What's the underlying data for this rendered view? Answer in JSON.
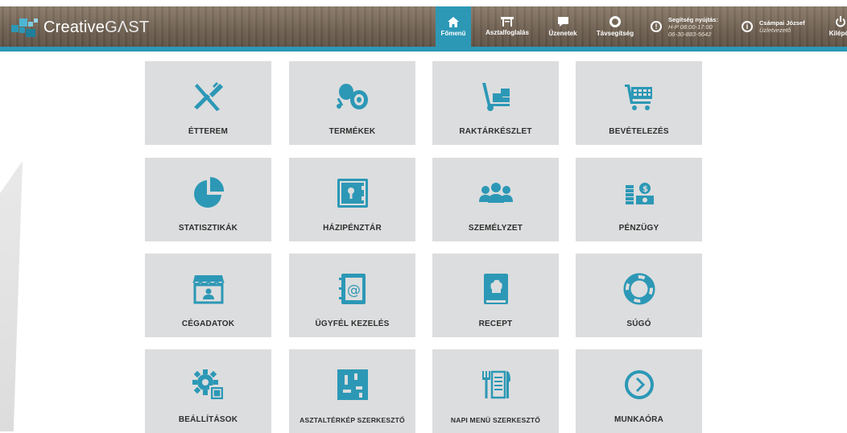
{
  "brand": {
    "name_a": "Creative",
    "name_b": "GΛST"
  },
  "colors": {
    "accent": "#2c98b6",
    "tile_bg": "#dcddde",
    "icon": "#2c98b6"
  },
  "nav": [
    {
      "label": "Főmenü",
      "icon": "home-icon",
      "active": true
    },
    {
      "label": "Asztalfoglalás",
      "icon": "table-icon",
      "active": false
    },
    {
      "label": "Üzenetek",
      "icon": "chat-icon",
      "active": false
    },
    {
      "label": "Távsegítség",
      "icon": "lifebuoy-icon",
      "active": false
    }
  ],
  "support": {
    "title": "Segítség nyújtás:",
    "hours": "H-P 08:00-17:00",
    "phone": "06-30-883-5642"
  },
  "user": {
    "name": "Csámpai József",
    "role": "Üzletvezető"
  },
  "logout": {
    "label": "Kilépés",
    "icon": "power-icon"
  },
  "tiles": [
    {
      "label": "ÉTTEREM",
      "icon": "cutlery-icon"
    },
    {
      "label": "TERMÉKEK",
      "icon": "meat-icon"
    },
    {
      "label": "RAKTÁRKÉSZLET",
      "icon": "hand-truck-icon"
    },
    {
      "label": "BEVÉTELEZÉS",
      "icon": "cart-icon"
    },
    {
      "label": "STATISZTIKÁK",
      "icon": "pie-chart-icon"
    },
    {
      "label": "HÁZIPÉNZTÁR",
      "icon": "safe-icon"
    },
    {
      "label": "SZEMÉLYZET",
      "icon": "people-icon"
    },
    {
      "label": "PÉNZÜGY",
      "icon": "money-icon"
    },
    {
      "label": "CÉGADATOK",
      "icon": "storefront-icon"
    },
    {
      "label": "ÜGYFÉL KEZELÉS",
      "icon": "address-book-icon"
    },
    {
      "label": "RECEPT",
      "icon": "recipe-book-icon"
    },
    {
      "label": "SÚGÓ",
      "icon": "help-lifebuoy-icon"
    },
    {
      "label": "BEÁLLÍTÁSOK",
      "icon": "settings-gear-icon"
    },
    {
      "label": "ASZTALTÉRKÉP SZERKESZTŐ",
      "icon": "floor-map-icon"
    },
    {
      "label": "NAPI MENÜ SZERKESZTŐ",
      "icon": "menu-card-icon"
    },
    {
      "label": "MUNKAÓRA",
      "icon": "clock-icon"
    }
  ]
}
